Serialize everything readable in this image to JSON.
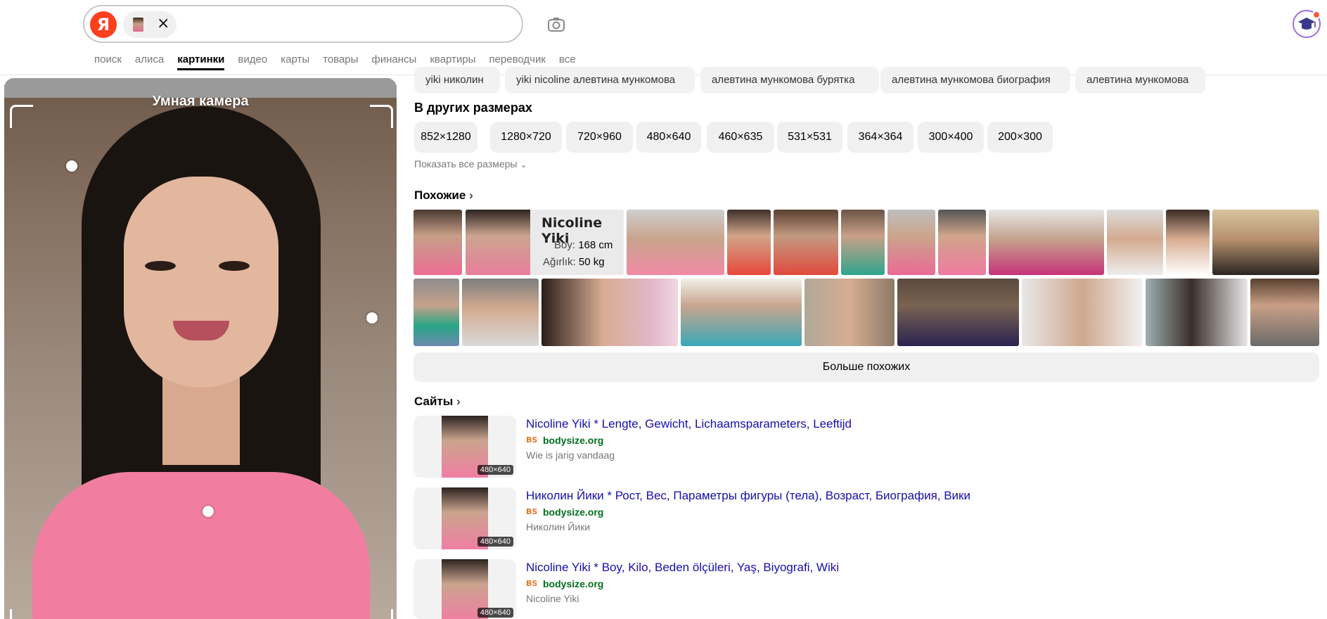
{
  "search": {
    "logo": "Я",
    "chip_close": "×",
    "camera_icon": "camera-icon"
  },
  "nav": [
    "поиск",
    "алиса",
    "картинки",
    "видео",
    "карты",
    "товары",
    "финансы",
    "квартиры",
    "переводчик",
    "все"
  ],
  "nav_active": "картинки",
  "left_panel": {
    "title": "Умная камера"
  },
  "tags": [
    "yiki николин",
    "yiki nicoline алевтина мункомова",
    "алевтина мункомова бурятка",
    "алевтина мункомова биография",
    "алевтина мункомова"
  ],
  "sizes": {
    "heading": "В других размерах",
    "items": [
      "852×1280",
      "1280×720",
      "720×960",
      "480×640",
      "460×635",
      "531×531",
      "364×364",
      "300×400",
      "200×300"
    ],
    "show_all": "Показать все размеры"
  },
  "similar": {
    "heading": "Похожие",
    "overlay_name": "Nicoline Yiki",
    "overlay_line1_label": "Boy:",
    "overlay_line1_value": "168 cm",
    "overlay_line2_label": "Ağırlık:",
    "overlay_line2_value": "50 kg",
    "more": "Больше похожих"
  },
  "sites": {
    "heading": "Сайты",
    "items": [
      {
        "title": "Nicoline Yiki * Lengte, Gewicht, Lichaamsparameters, Leeftijd",
        "domain": "bodysize.org",
        "desc": "Wie is jarig vandaag",
        "size": "480×640"
      },
      {
        "title": "Николин Йики * Рост, Вес, Параметры фигуры (тела), Возраст, Биография, Вики",
        "domain": "bodysize.org",
        "desc": "Николин Йики",
        "size": "480×640"
      },
      {
        "title": "Nicoline Yiki * Boy, Kilo, Beden ölçüleri, Yaş, Biyografi, Wiki",
        "domain": "bodysize.org",
        "desc": "Nicoline Yiki",
        "size": "480×640"
      }
    ]
  },
  "colors": {
    "accent": "#fc3f1d",
    "link": "#1a0dab",
    "domain": "#006e1d"
  }
}
